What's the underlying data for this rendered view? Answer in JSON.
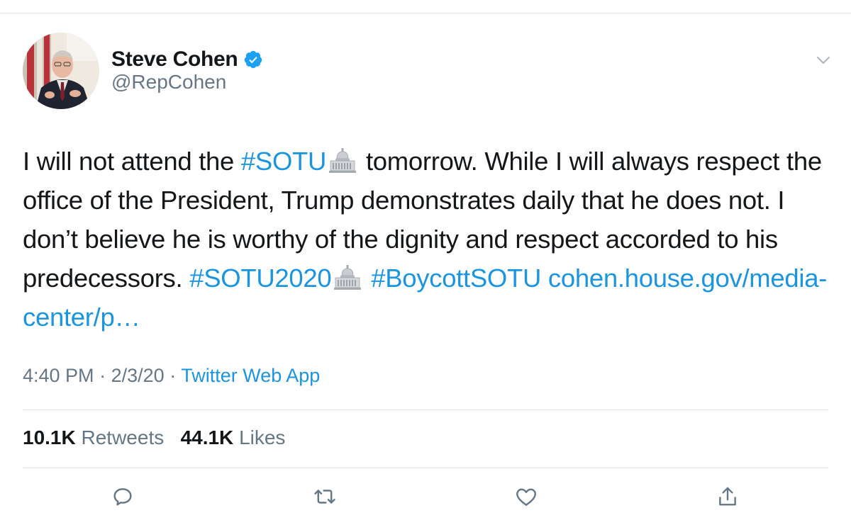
{
  "author": {
    "display_name": "Steve Cohen",
    "handle": "@RepCohen",
    "verified": true
  },
  "tweet": {
    "segments": [
      {
        "type": "text",
        "value": "I will not attend the "
      },
      {
        "type": "hashtag",
        "value": "#SOTU"
      },
      {
        "type": "emoji",
        "name": "capitol-building"
      },
      {
        "type": "text",
        "value": " tomorrow. While I will always respect the office of the President, Trump demonstrates daily that he does not. I don’t believe he is worthy of the dignity and respect accorded to his predecessors. "
      },
      {
        "type": "hashtag",
        "value": "#SOTU2020"
      },
      {
        "type": "emoji",
        "name": "capitol-building"
      },
      {
        "type": "text",
        "value": " "
      },
      {
        "type": "hashtag",
        "value": "#BoycottSOTU"
      },
      {
        "type": "text",
        "value": " "
      },
      {
        "type": "link",
        "value": "cohen.house.gov/media-center/p…"
      }
    ]
  },
  "meta": {
    "time": "4:40 PM",
    "date": "2/3/20",
    "source": "Twitter Web App",
    "sep": "·"
  },
  "stats": {
    "retweets_count": "10.1K",
    "retweets_label": "Retweets",
    "likes_count": "44.1K",
    "likes_label": "Likes"
  },
  "actions": [
    {
      "name": "reply-icon"
    },
    {
      "name": "retweet-icon"
    },
    {
      "name": "like-icon"
    },
    {
      "name": "share-icon"
    }
  ],
  "colors": {
    "link": "#1b95e0",
    "secondary": "#657786",
    "text": "#14171a",
    "divider": "#e1e8ed"
  }
}
